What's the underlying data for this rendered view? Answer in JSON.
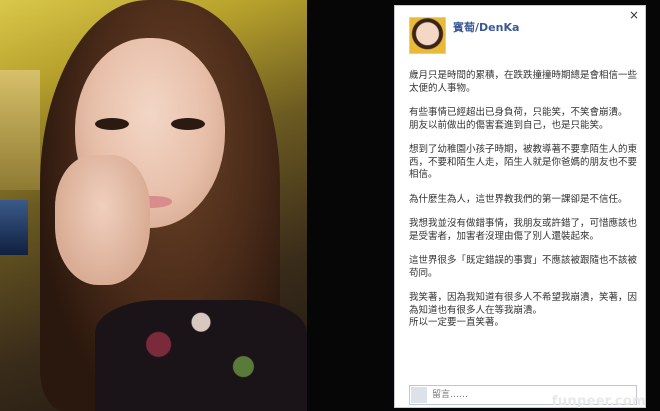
{
  "post": {
    "author": "賓萄/DenKa",
    "paragraphs": [
      "歲月只是時間的累積，在跌跌撞撞時期總是會相信一些太便的人事物。",
      "有些事情已經超出已身負荷，只能笑，不笑會崩潰。\n朋友以前做出的傷害套進到自己，也是只能笑。",
      "想到了幼稚園小孩子時期，被教導著不要拿陌生人的東西，不要和陌生人走，陌生人就是你爸媽的朋友也不要相信。",
      "為什麼生為人，這世界教我們的第一課卻是不信任。",
      "我想我並沒有做錯事情，我朋友或許錯了，可惜應該也是受害者，加害者沒理由傷了別人還裝起來。",
      "這世界很多「既定錯誤的事實」不應該被跟隨也不該被苟同。",
      "我笑著，因為我知道有很多人不希望我崩潰，笑著，因為知道也有很多人在等我崩潰。\n所以一定要一直笑著。"
    ]
  },
  "close_label": "×",
  "comment": {
    "placeholder": "留言……"
  },
  "watermark": "funpeer.com"
}
